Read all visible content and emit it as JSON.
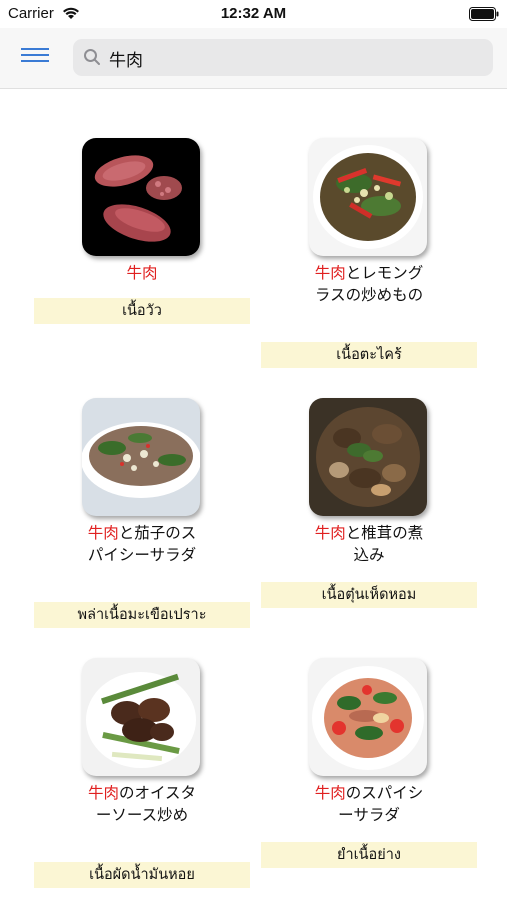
{
  "status": {
    "carrier": "Carrier",
    "time": "12:32 AM"
  },
  "search": {
    "query": "牛肉"
  },
  "items": [
    {
      "ja_highlight": "牛肉",
      "ja_rest": "",
      "thai": "เนื้อวัว",
      "image": "raw-beef-icon"
    },
    {
      "ja_highlight": "牛肉",
      "ja_rest": "とレモングラスの炒めもの",
      "thai": "เนื้อตะไคร้",
      "image": "beef-lemongrass-stirfry-icon"
    },
    {
      "ja_highlight": "牛肉",
      "ja_rest": "と茄子のスパイシーサラダ",
      "thai": "พล่าเนื้อมะเขือเปราะ",
      "image": "beef-eggplant-salad-icon"
    },
    {
      "ja_highlight": "牛肉",
      "ja_rest": "と椎茸の煮込み",
      "thai": "เนื้อตุ๋นเห็ดหอม",
      "image": "beef-shiitake-stew-icon"
    },
    {
      "ja_highlight": "牛肉",
      "ja_rest": "のオイスターソース炒め",
      "thai": "เนื้อผัดน้ำมันหอย",
      "image": "beef-oyster-sauce-icon"
    },
    {
      "ja_highlight": "牛肉",
      "ja_rest": "のスパイシーサラダ",
      "thai": "ยำเนื้อย่าง",
      "image": "spicy-beef-salad-icon"
    }
  ]
}
